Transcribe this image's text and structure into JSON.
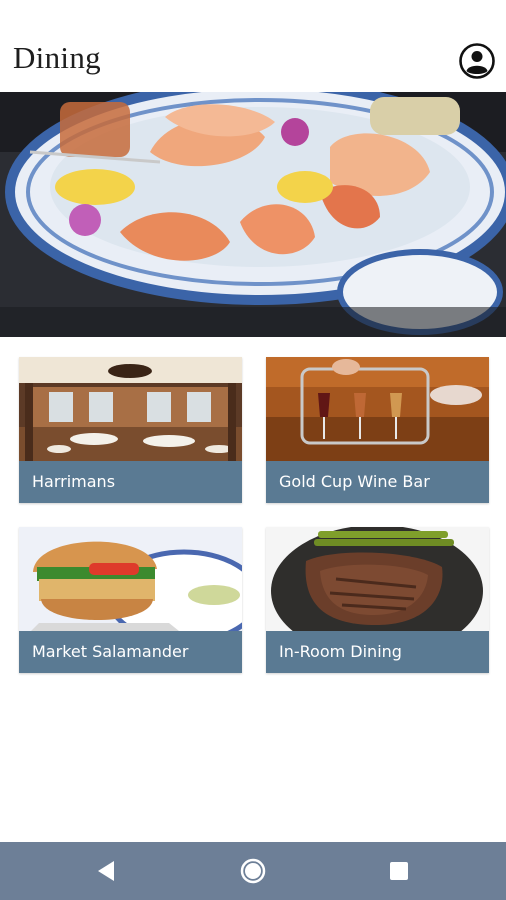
{
  "header": {
    "title": "Dining",
    "profile_icon": "account-circle-icon"
  },
  "hero": {
    "image": "seafood-platter-photo"
  },
  "cards": [
    {
      "label": "Harrimans",
      "image": "dining-room-photo"
    },
    {
      "label": "Gold Cup Wine Bar",
      "image": "wine-glasses-photo"
    },
    {
      "label": "Market Salamander",
      "image": "burger-photo"
    },
    {
      "label": "In-Room Dining",
      "image": "steak-photo"
    }
  ],
  "navbar": {
    "back_icon": "back-triangle-icon",
    "home_icon": "home-circle-icon",
    "recents_icon": "recents-square-icon"
  },
  "colors": {
    "card_label_bg": "#5a7a93",
    "navbar_bg": "#6d7f97",
    "text": "#1e1e1e"
  }
}
